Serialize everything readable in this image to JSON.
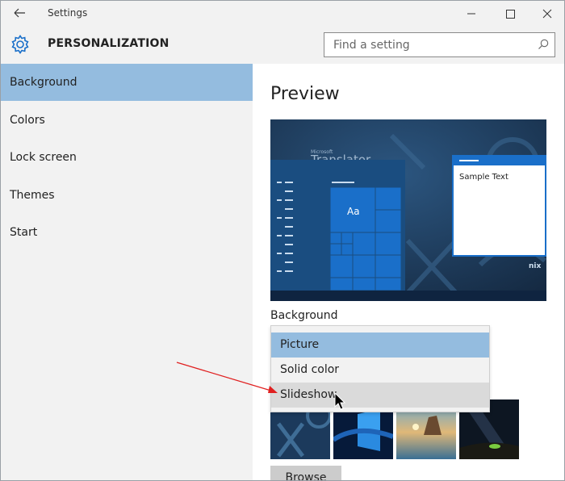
{
  "window": {
    "title": "Settings"
  },
  "header": {
    "title": "PERSONALIZATION"
  },
  "search": {
    "placeholder": "Find a setting"
  },
  "sidebar": {
    "items": [
      {
        "label": "Background",
        "active": true
      },
      {
        "label": "Colors",
        "active": false
      },
      {
        "label": "Lock screen",
        "active": false
      },
      {
        "label": "Themes",
        "active": false
      },
      {
        "label": "Start",
        "active": false
      }
    ]
  },
  "main": {
    "preview_title": "Preview",
    "preview": {
      "sample_text": "Sample Text",
      "tile_label": "Aa",
      "wallpaper_logo_small": "Microsoft",
      "wallpaper_logo_large": "Translator",
      "corner_mark": "nix"
    },
    "background_label": "Background",
    "background_options": [
      {
        "label": "Picture",
        "state": "selected"
      },
      {
        "label": "Solid color",
        "state": "normal"
      },
      {
        "label": "Slideshow",
        "state": "hover"
      }
    ],
    "browse_label": "Browse"
  },
  "colors": {
    "accent": "#94bcdf",
    "chrome": "#f2f2f2",
    "tile_blue": "#1a6fc9",
    "preview_bg": "#1f3b5c",
    "annotation_arrow": "#e02020"
  },
  "icons": [
    "back-arrow-icon",
    "minimize-icon",
    "maximize-icon",
    "close-icon",
    "gear-icon",
    "search-icon",
    "mouse-cursor-icon"
  ]
}
